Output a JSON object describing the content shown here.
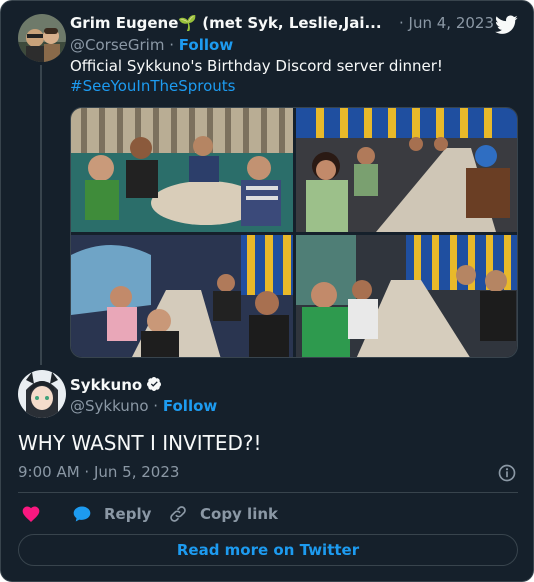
{
  "quoted_tweet": {
    "author_name": "Grim Eugene🌱 (met Syk, Leslie,Jai...",
    "handle": "@CorseGrim",
    "separator": "·",
    "follow_label": "Follow",
    "date": "· Jun 4, 2023",
    "text": "Official Sykkuno's Birthday Discord server dinner!",
    "hashtag": "#SeeYouInTheSprouts",
    "photo_count": 4
  },
  "tweet": {
    "author_name": "Sykkuno",
    "verified": true,
    "handle": "@Sykkuno",
    "separator": "·",
    "follow_label": "Follow",
    "text": "WHY WASNT I INVITED?!",
    "timestamp": "9:00 AM · Jun 5, 2023"
  },
  "actions": {
    "reply_label": "Reply",
    "copy_link_label": "Copy link"
  },
  "footer": {
    "read_more_label": "Read more on Twitter"
  },
  "colors": {
    "background": "#15202b",
    "accent": "#1d9bf0",
    "like": "#f91880",
    "muted": "#8b98a5"
  },
  "icons": [
    "twitter-bird-icon",
    "verified-badge-icon",
    "info-icon",
    "heart-icon",
    "reply-bubble-icon",
    "link-icon"
  ]
}
